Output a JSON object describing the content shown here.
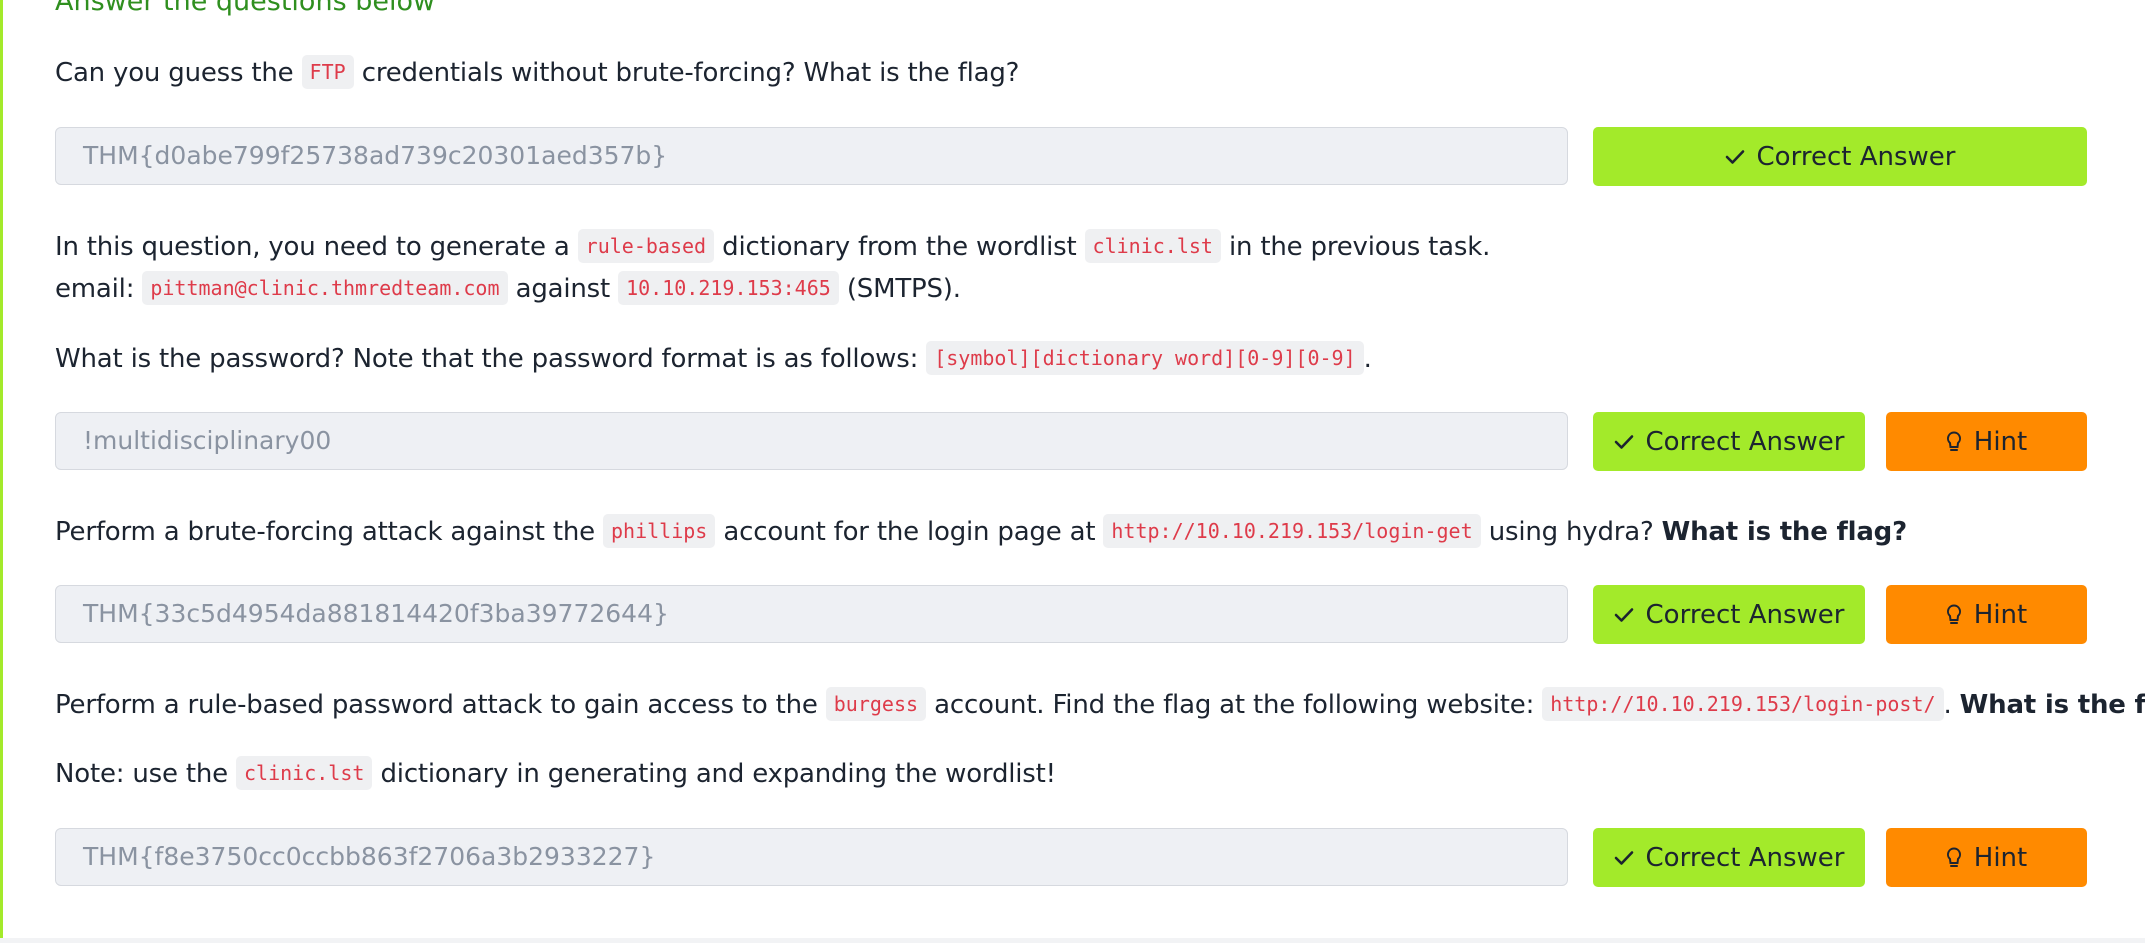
{
  "heading": "Answer the questions below",
  "q1": {
    "text_before": "Can you guess the ",
    "code": "FTP",
    "text_after": " credentials without brute-forcing? What is the flag?",
    "answer": "THM{d0abe799f25738ad739c20301aed357b}",
    "correct_label": "Correct Answer"
  },
  "q2": {
    "line1_a": "In this question, you need to generate a ",
    "line1_code1": "rule-based",
    "line1_b": " dictionary from the wordlist ",
    "line1_code2": "clinic.lst",
    "line1_c": " in the previous task.",
    "line2_a": "email: ",
    "line2_code1": "pittman@clinic.thmredteam.com",
    "line2_b": " against ",
    "line2_code2": "10.10.219.153:465",
    "line2_c": " (SMTPS).",
    "line3_a": "What is the password? Note that the password format is as follows: ",
    "line3_code": "[symbol][dictionary word][0-9][0-9]",
    "line3_b": ".",
    "answer": "!multidisciplinary00",
    "correct_label": "Correct Answer",
    "hint_label": "Hint"
  },
  "q3": {
    "text_a": "Perform a brute-forcing attack against the ",
    "code1": "phillips",
    "text_b": " account for the login page at ",
    "code2": "http://10.10.219.153/login-get",
    "text_c": " using hydra? ",
    "bold": "What is the flag?",
    "answer": "THM{33c5d4954da881814420f3ba39772644}",
    "correct_label": "Correct Answer",
    "hint_label": "Hint"
  },
  "q4": {
    "text_a": "Perform a rule-based password attack to gain access to the ",
    "code1": "burgess",
    "text_b": " account. Find the flag at the following website: ",
    "code2": "http://10.10.219.153/login-post/",
    "text_c": ". ",
    "bold": "What is the flag?",
    "note_a": "Note: use the ",
    "note_code": "clinic.lst",
    "note_b": " dictionary in generating and expanding the wordlist!",
    "answer": "THM{f8e3750cc0ccbb863f2706a3b2933227}",
    "correct_label": "Correct Answer",
    "hint_label": "Hint"
  },
  "colors": {
    "correct": "#a3ea2a",
    "hint": "#ff8a00",
    "code_text": "#de3b4a",
    "heading": "#2f8f1f"
  },
  "icons": {
    "correct": "check-icon",
    "hint": "lightbulb-icon"
  }
}
